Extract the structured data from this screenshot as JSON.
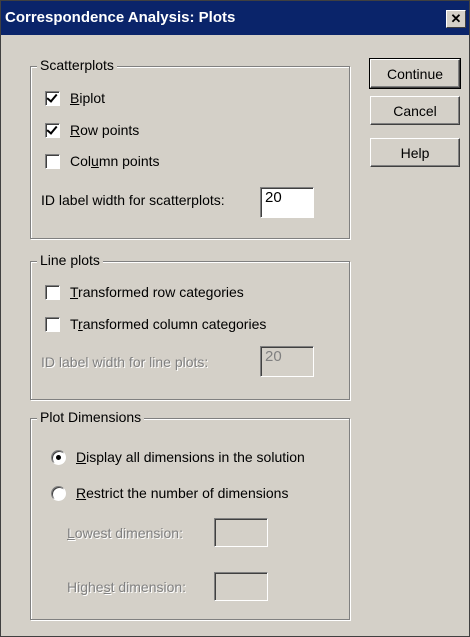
{
  "window": {
    "title": "Correspondence Analysis: Plots",
    "close_glyph": "✕"
  },
  "buttons": {
    "continue": "Continue",
    "cancel": "Cancel",
    "help": "Help"
  },
  "scatterplots": {
    "legend": "Scatterplots",
    "biplot": {
      "label_accel": "B",
      "label_rest": "iplot",
      "checked": true
    },
    "row_points": {
      "label_accel": "R",
      "label_rest": "ow points",
      "checked": true
    },
    "column_points": {
      "label_pre": "Col",
      "label_accel": "u",
      "label_rest": "mn points",
      "checked": false
    },
    "id_width": {
      "label": "ID label width for scatterplots:",
      "value": "20"
    }
  },
  "line_plots": {
    "legend": "Line plots",
    "transformed_row": {
      "label_accel": "T",
      "label_rest": "ransformed row categories",
      "checked": false
    },
    "transformed_col": {
      "label_pre": "T",
      "label_accel": "r",
      "label_rest": "ansformed column categories",
      "checked": false
    },
    "id_width": {
      "label": "ID label width for line plots:",
      "value": "20"
    }
  },
  "plot_dimensions": {
    "legend": "Plot Dimensions",
    "display_all": {
      "label_accel": "D",
      "label_rest": "isplay all dimensions in the solution",
      "selected": true
    },
    "restrict": {
      "label_accel": "R",
      "label_rest": "estrict the number of dimensions",
      "selected": false
    },
    "lowest": {
      "label_accel": "L",
      "label_rest": "owest dimension:",
      "value": ""
    },
    "highest": {
      "label_pre": "Highe",
      "label_accel": "s",
      "label_rest": "t dimension:",
      "value": ""
    }
  }
}
